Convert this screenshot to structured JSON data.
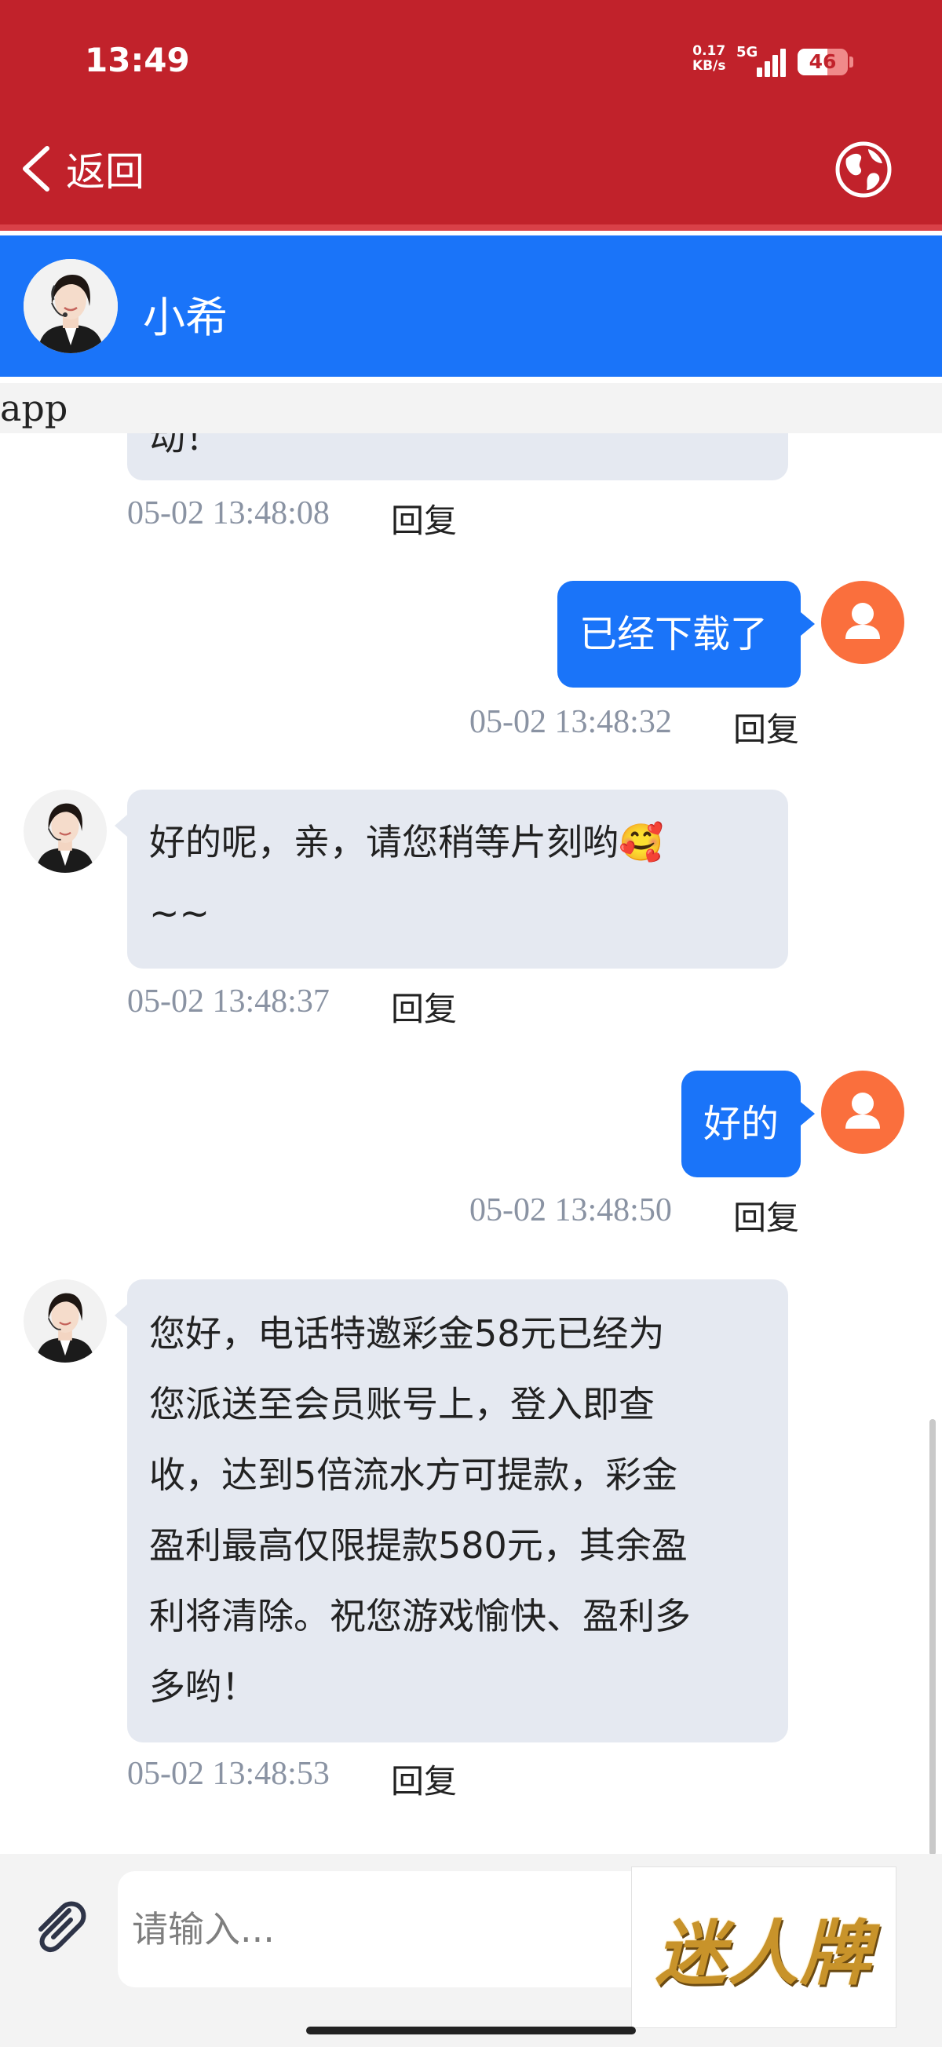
{
  "status_bar": {
    "time": "13:49",
    "net_speed_value": "0.17",
    "net_speed_unit": "KB/s",
    "network": "5G",
    "battery": "46"
  },
  "header": {
    "back_label": "返回",
    "back_icon": "chevron-left-icon",
    "globe_icon": "globe-icon",
    "bg_color": "#c1222b"
  },
  "agent": {
    "name": "小希",
    "bar_color": "#1a74f9"
  },
  "app_label": "app",
  "messages": [
    {
      "side": "left",
      "text": "动！",
      "time": "05-02 13:48:08",
      "reply": "回复"
    },
    {
      "side": "right",
      "text": "已经下载了",
      "time": "05-02 13:48:32",
      "reply": "回复"
    },
    {
      "side": "left",
      "lines": [
        "好的呢，亲，请您稍等片刻哟🥰",
        "~~"
      ],
      "time": "05-02 13:48:37",
      "reply": "回复"
    },
    {
      "side": "right",
      "text": "好的",
      "time": "05-02 13:48:50",
      "reply": "回复"
    },
    {
      "side": "left",
      "lines": [
        "您好，电话特邀彩金58元已经为",
        "您派送至会员账号上，登入即查",
        "收，达到5倍流水方可提款，彩金",
        "盈利最高仅限提款580元，其余盈",
        "利将清除。祝您游戏愉快、盈利多",
        "多哟！"
      ],
      "time": "05-02 13:48:53",
      "reply": "回复"
    }
  ],
  "input": {
    "placeholder": "请输入...",
    "attach_icon": "paperclip-icon"
  },
  "brand": "迷人牌"
}
